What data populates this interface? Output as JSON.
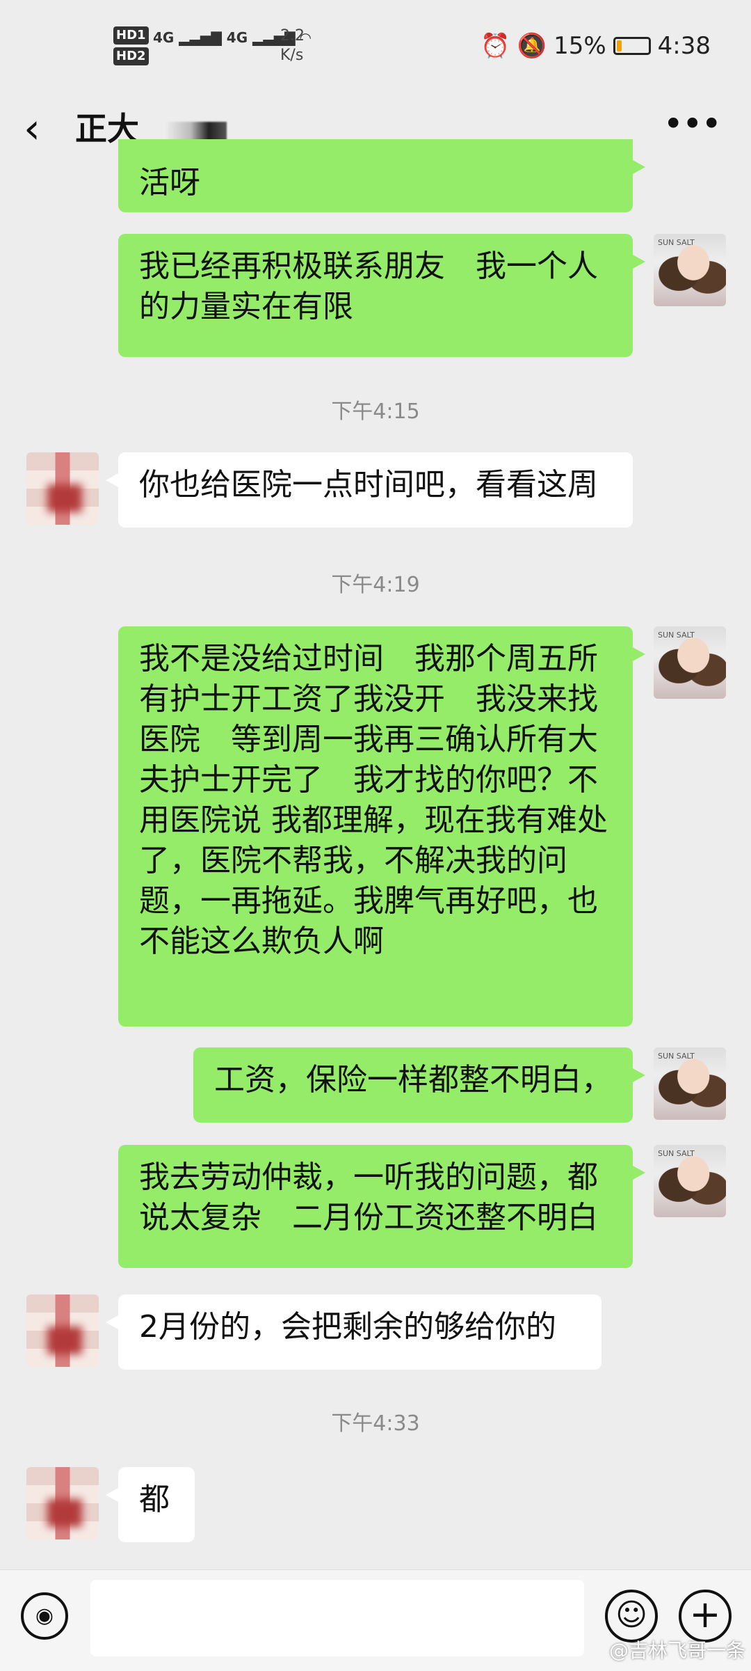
{
  "status_bar": {
    "hd1": "HD1",
    "hd2": "HD2",
    "network": "4G 4G",
    "speed_value": "2.2",
    "speed_unit": "K/s",
    "battery": "15%",
    "time": "4:38",
    "battery_level": 0.15
  },
  "header": {
    "back_icon": "back-chevron-icon",
    "title": "正大",
    "more_icon": "more-dots-icon"
  },
  "messages": [
    {
      "from": "me",
      "text": "活呀"
    },
    {
      "from": "me",
      "text": "我已经再积极联系朋友　我一个人的力量实在有限"
    },
    {
      "type": "time",
      "text": "下午4:15"
    },
    {
      "from": "other",
      "text": "你也给医院一点时间吧，看看这周"
    },
    {
      "type": "time",
      "text": "下午4:19"
    },
    {
      "from": "me",
      "text": "我不是没给过时间　我那个周五所有护士开工资了我没开　我没来找医院　等到周一我再三确认所有大夫护士开完了　我才找的你吧？不用医院说 我都理解，现在我有难处了，医院不帮我，不解决我的问题，一再拖延。我脾气再好吧，也不能这么欺负人啊"
    },
    {
      "from": "me",
      "text": "工资，保险一样都整不明白，"
    },
    {
      "from": "me",
      "text": "我去劳动仲裁，一听我的问题，都说太复杂　二月份工资还整不明白"
    },
    {
      "from": "other",
      "text": "2月份的，会把剩余的够给你的"
    },
    {
      "type": "time",
      "text": "下午4:33"
    },
    {
      "from": "other",
      "text": "都"
    }
  ],
  "avatar_me_text": "SUN SALT",
  "bottom_bar": {
    "voice_icon": "voice-icon",
    "emoji_icon": "emoji-icon",
    "plus_icon": "plus-icon"
  },
  "watermark": "@吉林飞哥一条"
}
